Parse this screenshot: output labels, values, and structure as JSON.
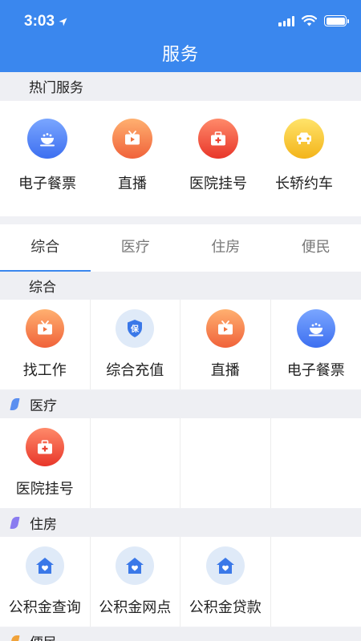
{
  "status_bar": {
    "time": "3:03"
  },
  "header": {
    "title": "服务"
  },
  "hot_section": {
    "title": "热门服务",
    "items": [
      {
        "label": "电子餐票",
        "icon": "meal-ticket-icon",
        "color": "#4b7cf5"
      },
      {
        "label": "直播",
        "icon": "tv-play-icon",
        "color": "#f27a47"
      },
      {
        "label": "医院挂号",
        "icon": "medical-kit-icon",
        "color": "#ef4a36"
      },
      {
        "label": "长轿约车",
        "icon": "car-icon",
        "color": "#f6c12b"
      }
    ]
  },
  "tabs": [
    {
      "label": "综合",
      "active": true
    },
    {
      "label": "医疗",
      "active": false
    },
    {
      "label": "住房",
      "active": false
    },
    {
      "label": "便民",
      "active": false
    }
  ],
  "sections": [
    {
      "title": "综合",
      "items": [
        {
          "label": "找工作",
          "icon": "tv-play-icon"
        },
        {
          "label": "综合充值",
          "icon": "shield-bao-icon",
          "glyph": "保"
        },
        {
          "label": "直播",
          "icon": "tv-play-icon"
        },
        {
          "label": "电子餐票",
          "icon": "meal-ticket-icon"
        }
      ]
    },
    {
      "title": "医疗",
      "mark_color": "#5b8ff0",
      "items": [
        {
          "label": "医院挂号",
          "icon": "medical-kit-icon"
        }
      ]
    },
    {
      "title": "住房",
      "mark_color": "#8a7cf0",
      "items": [
        {
          "label": "公积金查询",
          "icon": "house-heart-icon"
        },
        {
          "label": "公积金网点",
          "icon": "house-heart-icon"
        },
        {
          "label": "公积金贷款",
          "icon": "house-heart-icon"
        }
      ]
    },
    {
      "title": "便民",
      "mark_color": "#f0a23a"
    }
  ]
}
